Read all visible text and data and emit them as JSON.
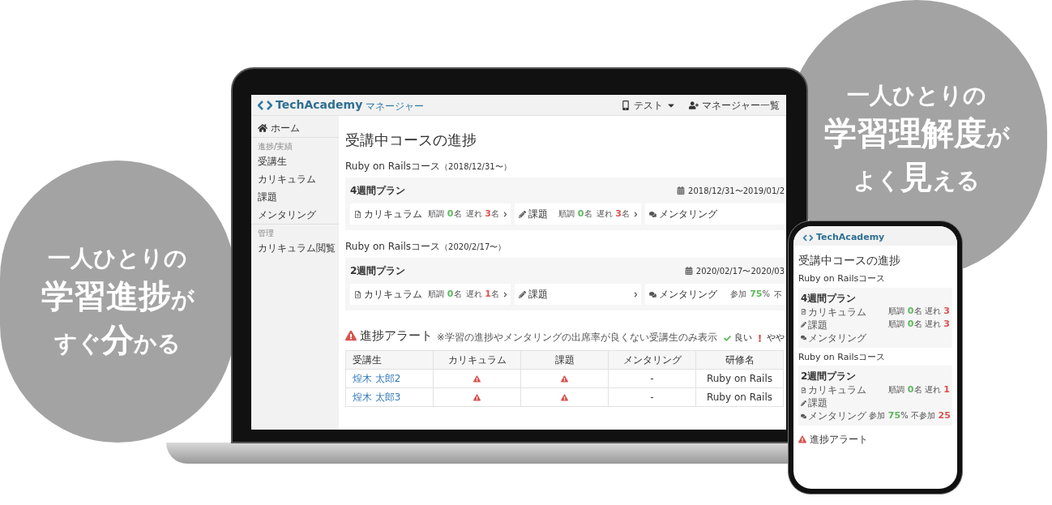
{
  "callouts": [
    {
      "lines": [
        [
          {
            "text": "一人ひとりの",
            "big": false
          }
        ],
        [
          {
            "text": "学習進捗",
            "big": true
          },
          {
            "text": "が",
            "big": false
          }
        ],
        [
          {
            "text": "すぐ",
            "big": false
          },
          {
            "text": "分",
            "big": true
          },
          {
            "text": "かる",
            "big": false
          }
        ]
      ]
    },
    {
      "lines": [
        [
          {
            "text": "一人ひとりの",
            "big": false
          }
        ],
        [
          {
            "text": "学習理解度",
            "big": true
          },
          {
            "text": "が",
            "big": false
          }
        ],
        [
          {
            "text": "よく",
            "big": false
          },
          {
            "text": "見",
            "big": true
          },
          {
            "text": "える",
            "big": false
          }
        ]
      ]
    }
  ],
  "laptop": {
    "header": {
      "logo": "TechAcademy",
      "logo_sub": "マネージャー",
      "menus": [
        {
          "kind": "dropdown",
          "label": "テスト"
        },
        {
          "kind": "link",
          "label": "マネージャー一覧"
        }
      ]
    },
    "sidebar": [
      {
        "kind": "home",
        "label": "ホーム"
      },
      {
        "kind": "section",
        "label": "進捗/実績"
      },
      {
        "kind": "item",
        "label": "受講生"
      },
      {
        "kind": "item",
        "label": "カリキュラム"
      },
      {
        "kind": "item",
        "label": "課題"
      },
      {
        "kind": "item",
        "label": "メンタリング"
      },
      {
        "kind": "section",
        "label": "管理"
      },
      {
        "kind": "item",
        "label": "カリキュラム閲覧"
      }
    ],
    "title": "受講中コースの進捗",
    "courses": [
      {
        "name": "Ruby on Railsコース",
        "period": "（2018/12/31〜）",
        "plan": "4週間プラン",
        "dates": "2018/12/31〜2019/01/2",
        "cards": [
          {
            "kind": "curriculum",
            "label": "カリキュラム",
            "chevron": true,
            "stats": [
              {
                "label": "順調",
                "value": "0",
                "unit": "名",
                "alert": false
              },
              {
                "label": "遅れ",
                "value": "3",
                "unit": "名",
                "alert": true
              }
            ]
          },
          {
            "kind": "assignment",
            "label": "課題",
            "chevron": true,
            "stats": [
              {
                "label": "順調",
                "value": "0",
                "unit": "名",
                "alert": false
              },
              {
                "label": "遅れ",
                "value": "3",
                "unit": "名",
                "alert": true
              }
            ]
          },
          {
            "kind": "mentoring",
            "label": "メンタリング",
            "chevron": false
          }
        ]
      },
      {
        "name": "Ruby on Railsコース",
        "period": "（2020/2/17〜）",
        "plan": "2週間プラン",
        "dates": "2020/02/17〜2020/03",
        "cards": [
          {
            "kind": "curriculum",
            "label": "カリキュラム",
            "chevron": true,
            "stats": [
              {
                "label": "順調",
                "value": "0",
                "unit": "名",
                "alert": false
              },
              {
                "label": "遅れ",
                "value": "1",
                "unit": "名",
                "alert": true
              }
            ]
          },
          {
            "kind": "assignment",
            "label": "課題",
            "chevron": true
          },
          {
            "kind": "mentoring",
            "label": "メンタリング",
            "chevron": false,
            "stats": [
              {
                "label": "参加",
                "value": "75",
                "unit": "%",
                "alert": false
              },
              {
                "label": "不"
              }
            ]
          }
        ]
      }
    ],
    "alert": {
      "title": "進捗アラート",
      "note": "※学習の進捗やメンタリングの出席率が良くない受講生のみ表示",
      "legend": [
        {
          "kind": "good",
          "label": "良い"
        },
        {
          "kind": "warn",
          "label": "やや"
        }
      ],
      "columns": [
        "受講生",
        "カリキュラム",
        "課題",
        "メンタリング",
        "研修名"
      ],
      "rows": [
        {
          "cells": [
            {
              "kind": "link",
              "text": "煌木 太郎2"
            },
            {
              "kind": "alert"
            },
            {
              "kind": "alert"
            },
            {
              "kind": "text",
              "text": "-"
            },
            {
              "kind": "text",
              "text": "Ruby on Rails"
            }
          ]
        },
        {
          "cells": [
            {
              "kind": "link",
              "text": "煌木 太郎3"
            },
            {
              "kind": "alert"
            },
            {
              "kind": "alert"
            },
            {
              "kind": "text",
              "text": "-"
            },
            {
              "kind": "text",
              "text": "Ruby on Rails"
            }
          ]
        }
      ]
    }
  },
  "phone": {
    "logo": "TechAcademy",
    "title": "受講中コースの進捗",
    "courses": [
      {
        "name": "Ruby on Railsコース",
        "plan": "4週間プラン",
        "rows": [
          {
            "kind": "curriculum",
            "label": "カリキュラム",
            "stats": [
              {
                "label": "順調",
                "value": "0",
                "unit": "名",
                "alert": false
              },
              {
                "label": "遅れ",
                "value": "3",
                "alert": true
              }
            ]
          },
          {
            "kind": "assignment",
            "label": "課題",
            "stats": [
              {
                "label": "順調",
                "value": "0",
                "unit": "名",
                "alert": false
              },
              {
                "label": "遅れ",
                "value": "3",
                "alert": true
              }
            ]
          },
          {
            "kind": "mentoring",
            "label": "メンタリング"
          }
        ]
      },
      {
        "name": "Ruby on Railsコース",
        "plan": "2週間プラン",
        "rows": [
          {
            "kind": "curriculum",
            "label": "カリキュラム",
            "stats": [
              {
                "label": "順調",
                "value": "0",
                "unit": "名",
                "alert": false
              },
              {
                "label": "遅れ",
                "value": "1",
                "alert": true
              }
            ]
          },
          {
            "kind": "assignment",
            "label": "課題"
          },
          {
            "kind": "mentoring",
            "label": "メンタリング",
            "stats": [
              {
                "label": "参加",
                "value": "75",
                "unit": "%",
                "alert": false
              },
              {
                "label": "不参加",
                "value": "25",
                "alert": true
              }
            ]
          }
        ]
      }
    ],
    "alert_title": "進捗アラート"
  }
}
